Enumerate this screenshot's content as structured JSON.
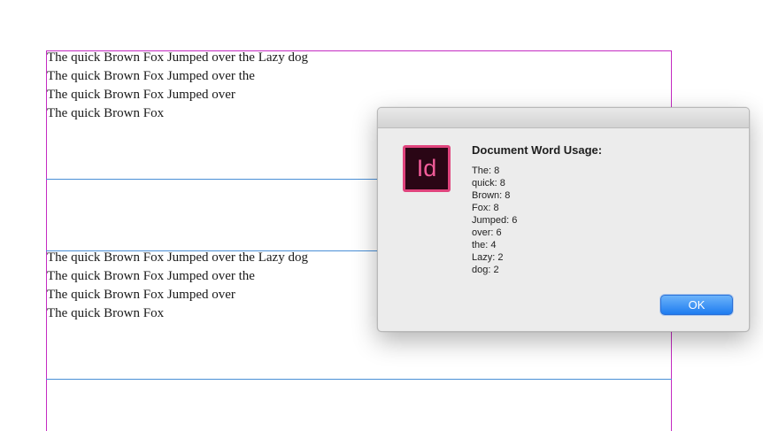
{
  "document": {
    "frames": [
      {
        "lines": [
          "The quick Brown Fox Jumped over the Lazy dog",
          "The quick Brown Fox Jumped over the",
          "The quick Brown Fox Jumped over",
          "The quick Brown Fox"
        ]
      },
      {
        "lines": [
          "The quick Brown Fox Jumped over the Lazy dog",
          "The quick Brown Fox Jumped over the",
          "The quick Brown Fox Jumped over",
          "The quick Brown Fox"
        ]
      }
    ],
    "colors": {
      "margin_guide": "#c42bc2",
      "frame_edge": "#4a8fd6"
    }
  },
  "dialog": {
    "app_icon_text": "Id",
    "app_icon": "indesign-app-icon",
    "title": "Document Word Usage:",
    "word_counts": [
      "The: 8",
      "quick: 8",
      "Brown: 8",
      "Fox: 8",
      "Jumped: 6",
      "over: 6",
      "the: 4",
      "Lazy: 2",
      "dog: 2"
    ],
    "ok_label": "OK",
    "colors": {
      "accent": "#1e7cf0",
      "icon_border": "#e0447d",
      "icon_bg": "#2a0615"
    }
  }
}
